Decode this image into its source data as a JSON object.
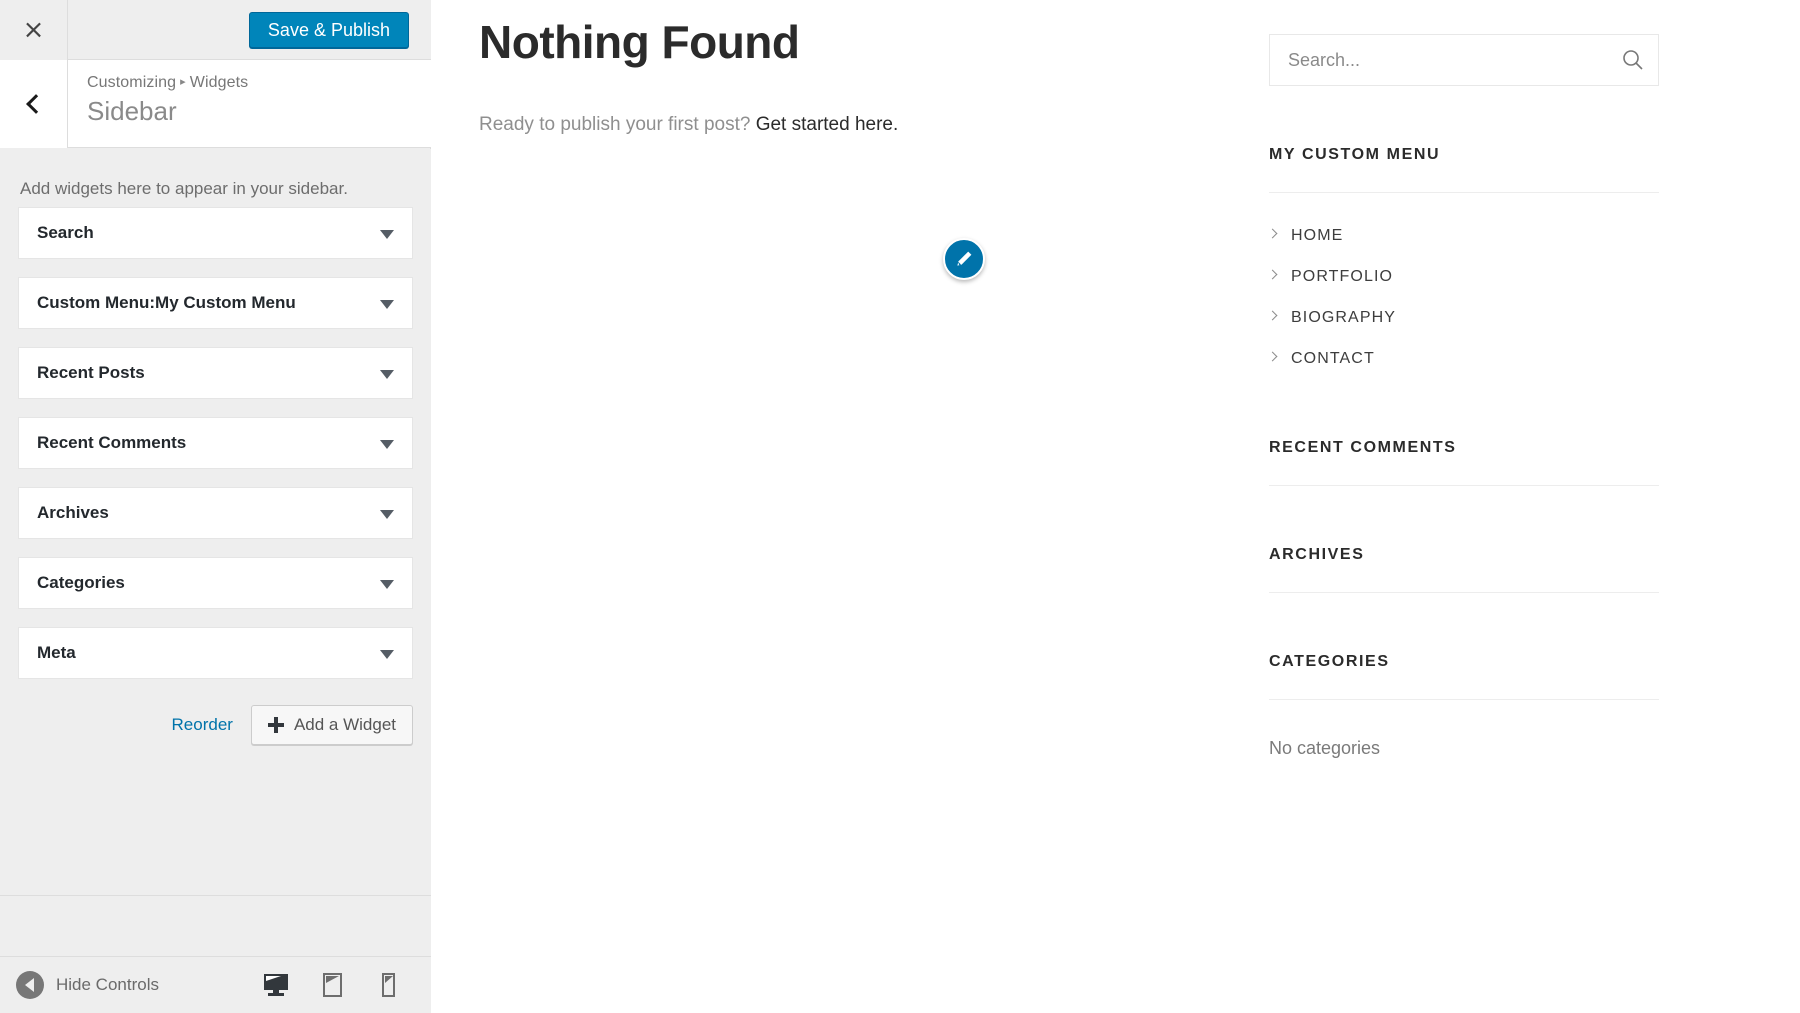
{
  "customizer": {
    "close_label": "×",
    "save_label": "Save & Publish",
    "back_label": "‹",
    "breadcrumb_root": "Customizing",
    "breadcrumb_sep": "▸",
    "breadcrumb_current": "Widgets",
    "panel_title": "Sidebar",
    "sidebar_description": "Add widgets here to appear in your sidebar.",
    "widgets": [
      {
        "title": "Search",
        "subtitle": ""
      },
      {
        "title": "Custom Menu:",
        "subtitle": " My Custom Menu"
      },
      {
        "title": "Recent Posts",
        "subtitle": ""
      },
      {
        "title": "Recent Comments",
        "subtitle": ""
      },
      {
        "title": "Archives",
        "subtitle": ""
      },
      {
        "title": "Categories",
        "subtitle": ""
      },
      {
        "title": "Meta",
        "subtitle": ""
      }
    ],
    "reorder_label": "Reorder",
    "add_widget_label": "Add a Widget",
    "hide_controls_label": "Hide Controls",
    "devices": [
      {
        "name": "desktop"
      },
      {
        "name": "tablet"
      },
      {
        "name": "mobile"
      }
    ],
    "accent_color": "#0085ba",
    "link_color": "#0073aa"
  },
  "preview": {
    "page_title": "Nothing Found",
    "page_sub_prefix": "Ready to publish your first post? ",
    "page_sub_link": "Get started here.",
    "search": {
      "placeholder": "Search...",
      "value": "",
      "icon": "search-icon"
    },
    "sidebar_widgets": [
      {
        "heading": "MY CUSTOM MENU",
        "items": [
          "HOME",
          "PORTFOLIO",
          "BIOGRAPHY",
          "CONTACT"
        ]
      },
      {
        "heading": "RECENT COMMENTS",
        "items": []
      },
      {
        "heading": "ARCHIVES",
        "items": []
      },
      {
        "heading": "CATEGORIES",
        "items": [],
        "empty_text": "No categories"
      }
    ],
    "edit_shortcut_icon": "pencil-icon",
    "edit_shortcut_color": "#0073aa"
  }
}
